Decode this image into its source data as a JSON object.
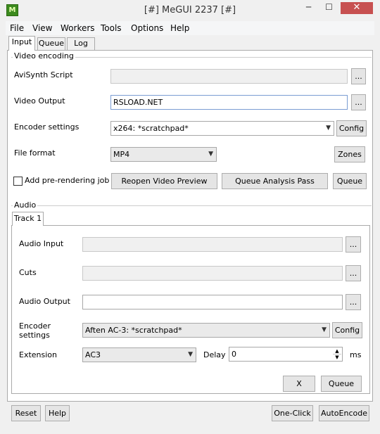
{
  "window": {
    "title": "[#] MeGUI 2237 [#]",
    "icon": "megui-app-icon",
    "min": "─",
    "max": "☐",
    "close": "✕"
  },
  "menu": [
    "File",
    "View",
    "Workers",
    "Tools",
    "Options",
    "Help"
  ],
  "tabs": [
    "Input",
    "Queue",
    "Log"
  ],
  "video": {
    "group_label": "Video encoding",
    "avisynth_label": "AviSynth Script",
    "avisynth_value": "",
    "output_label": "Video Output",
    "output_value": "RSLOAD.NET",
    "encoder_label": "Encoder settings",
    "encoder_value": "x264: *scratchpad*",
    "format_label": "File format",
    "format_value": "MP4",
    "browse": "...",
    "config": "Config",
    "zones": "Zones",
    "prerender_label": "Add pre-rendering job",
    "prerender_checked": false,
    "reopen_preview": "Reopen Video Preview",
    "queue_analysis": "Queue Analysis Pass",
    "queue": "Queue"
  },
  "audio": {
    "group_label": "Audio",
    "track_tab": "Track 1",
    "input_label": "Audio Input",
    "cuts_label": "Cuts",
    "output_label": "Audio Output",
    "encoder_label": "Encoder settings",
    "encoder_value": "Aften AC-3: *scratchpad*",
    "extension_label": "Extension",
    "extension_value": "AC3",
    "delay_label": "Delay",
    "delay_value": "0",
    "delay_unit": "ms",
    "browse": "...",
    "config": "Config",
    "x": "X",
    "queue": "Queue"
  },
  "footer": {
    "reset": "Reset",
    "help": "Help",
    "one_click": "One-Click",
    "auto_encode": "AutoEncode"
  }
}
